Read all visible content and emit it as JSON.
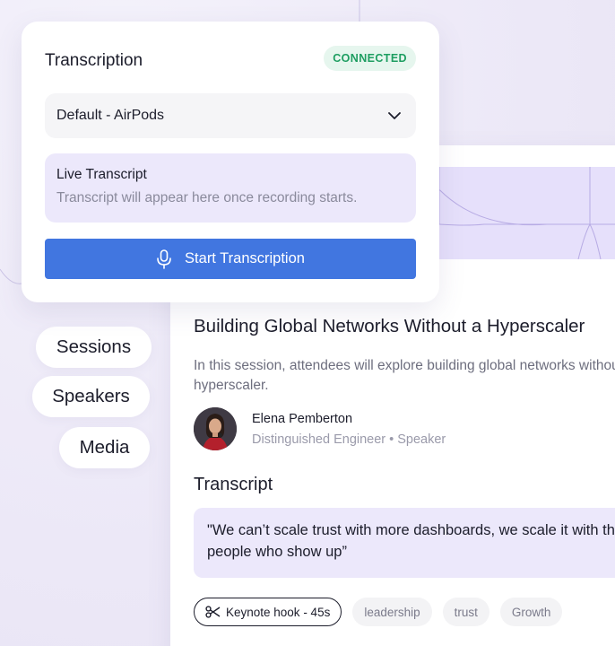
{
  "transcription": {
    "title": "Transcription",
    "status": "CONNECTED",
    "device": "Default - AirPods",
    "live_title": "Live Transcript",
    "live_placeholder": "Transcript will appear here once recording starts.",
    "start_label": "Start Transcription"
  },
  "nav": {
    "items": [
      {
        "label": "Sessions"
      },
      {
        "label": "Speakers"
      },
      {
        "label": "Media"
      }
    ]
  },
  "session": {
    "title": "Building Global Networks Without a Hyperscaler",
    "description": "In this session, attendees will explore building global networks without a hyperscaler.",
    "speaker_name": "Elena Pemberton",
    "speaker_role": "Distinguished Engineer • Speaker",
    "transcript_heading": "Transcript",
    "quote": "\"We can’t scale trust with more dashboards, we scale it with the people who show up”",
    "tags": [
      {
        "label": "Keynote hook - 45s"
      },
      {
        "label": "leadership"
      },
      {
        "label": "trust"
      },
      {
        "label": "Growth"
      }
    ]
  },
  "colors": {
    "accent": "#4176e0",
    "connected": "#1e9e61",
    "lavender": "#ece8fb"
  },
  "icons": [
    "chevron-down-icon",
    "microphone-icon",
    "scissors-icon"
  ]
}
